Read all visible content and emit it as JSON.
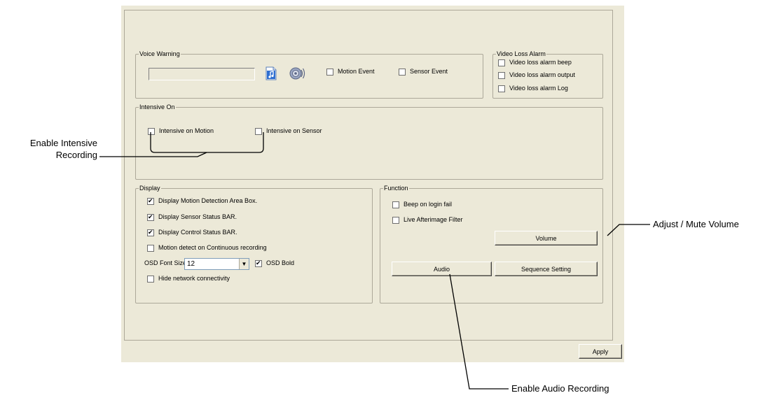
{
  "voice_warning": {
    "title": "Voice Warning",
    "file_value": "",
    "motion_event_label": "Motion Event",
    "motion_event_checked": false,
    "sensor_event_label": "Sensor Event",
    "sensor_event_checked": false,
    "icons": [
      "music-file-icon",
      "speaker-icon"
    ]
  },
  "video_loss_alarm": {
    "title": "Video Loss Alarm",
    "items": [
      {
        "label": "Video loss alarm beep",
        "checked": false
      },
      {
        "label": "Video loss alarm output",
        "checked": false
      },
      {
        "label": "Video loss alarm Log",
        "checked": false
      }
    ]
  },
  "intensive_on": {
    "title": "Intensive On",
    "motion_label": "Intensive on Motion",
    "motion_checked": false,
    "sensor_label": "Intensive on Sensor",
    "sensor_checked": false
  },
  "display": {
    "title": "Display",
    "items": [
      {
        "label": "Display Motion Detection Area Box.",
        "checked": true
      },
      {
        "label": "Display Sensor Status BAR.",
        "checked": true
      },
      {
        "label": "Display Control Status BAR.",
        "checked": true
      },
      {
        "label": "Motion detect on Continuous recording",
        "checked": false
      }
    ],
    "osd_font_size_label": "OSD Font Size :",
    "osd_font_size_value": "12",
    "osd_bold_label": "OSD Bold",
    "osd_bold_checked": true,
    "hide_network_label": "Hide network connectivity",
    "hide_network_checked": false
  },
  "function": {
    "title": "Function",
    "beep_label": "Beep on login fail",
    "beep_checked": false,
    "afterimage_label": "Live Afterimage Filter",
    "afterimage_checked": false,
    "volume_button": "Volume",
    "audio_button": "Audio",
    "sequence_button": "Sequence Setting"
  },
  "apply_button": "Apply",
  "callouts": {
    "intensive": "Enable Intensive\nRecording",
    "intensive_line1": "Enable Intensive",
    "intensive_line2": "Recording",
    "volume": "Adjust / Mute Volume",
    "audio": "Enable Audio Recording"
  },
  "colors": {
    "dialog_bg": "#ece9d8",
    "group_border": "#aca899",
    "callout_line": "#000000"
  }
}
